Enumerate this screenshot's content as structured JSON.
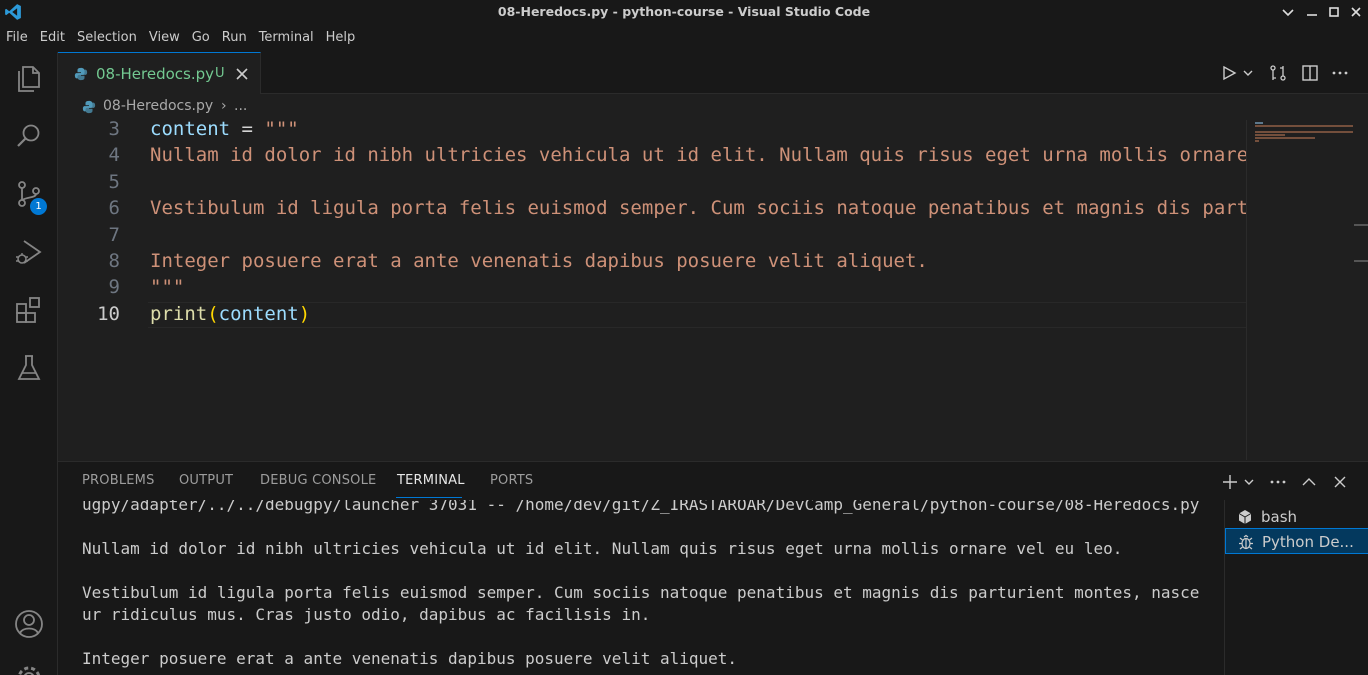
{
  "window": {
    "title": "08-Heredocs.py - python-course - Visual Studio Code"
  },
  "menu": [
    "File",
    "Edit",
    "Selection",
    "View",
    "Go",
    "Run",
    "Terminal",
    "Help"
  ],
  "activity": {
    "scm_badge": "1"
  },
  "tab": {
    "label": "08-Heredocs.py",
    "status": "U"
  },
  "breadcrumb": {
    "file": "08-Heredocs.py",
    "separator": "›",
    "more": "..."
  },
  "editor": {
    "lines": [
      {
        "num": "3",
        "tokens": [
          {
            "t": "content",
            "c": "var"
          },
          {
            "t": " = ",
            "c": "op"
          },
          {
            "t": "\"\"\"",
            "c": "str"
          }
        ]
      },
      {
        "num": "4",
        "tokens": [
          {
            "t": "Nullam id dolor id nibh ultricies vehicula ut id elit. Nullam quis risus eget urna mollis ornare vel eu leo.",
            "c": "str"
          }
        ]
      },
      {
        "num": "5",
        "tokens": []
      },
      {
        "num": "6",
        "tokens": [
          {
            "t": "Vestibulum id ligula porta felis euismod semper. Cum sociis natoque penatibus et magnis dis parturient montes",
            "c": "str"
          }
        ]
      },
      {
        "num": "7",
        "tokens": []
      },
      {
        "num": "8",
        "tokens": [
          {
            "t": "Integer posuere erat a ante venenatis dapibus posuere velit aliquet.",
            "c": "str"
          }
        ]
      },
      {
        "num": "9",
        "tokens": [
          {
            "t": "\"\"\"",
            "c": "str"
          }
        ]
      },
      {
        "num": "10",
        "tokens": [
          {
            "t": "print",
            "c": "fn"
          },
          {
            "t": "(",
            "c": "paren"
          },
          {
            "t": "content",
            "c": "var"
          },
          {
            "t": ")",
            "c": "paren"
          }
        ],
        "current": true
      }
    ]
  },
  "panel": {
    "tabs": [
      "PROBLEMS",
      "OUTPUT",
      "DEBUG CONSOLE",
      "TERMINAL",
      "PORTS"
    ],
    "active_tab": "TERMINAL",
    "terminal_lines": [
      "ugpy/adapter/../../debugpy/launcher 37031 -- /home/dev/git/Z_IRASTAROAR/DevCamp_General/python-course/08-Heredocs.py",
      "",
      "Nullam id dolor id nibh ultricies vehicula ut id elit. Nullam quis risus eget urna mollis ornare vel eu leo.",
      "",
      "Vestibulum id ligula porta felis euismod semper. Cum sociis natoque penatibus et magnis dis parturient montes, nasce",
      "ur ridiculus mus. Cras justo odio, dapibus ac facilisis in.",
      "",
      "Integer posuere erat a ante venenatis dapibus posuere velit aliquet."
    ],
    "terminals": [
      {
        "label": "bash",
        "icon": "terminal-bash-icon"
      },
      {
        "label": "Python De...",
        "icon": "debug-icon",
        "selected": true
      }
    ]
  },
  "colors": {
    "accent": "#0078d4",
    "string": "#ce9178",
    "variable": "#9cdcfe",
    "function": "#dcdcaa",
    "untracked": "#73c991"
  }
}
